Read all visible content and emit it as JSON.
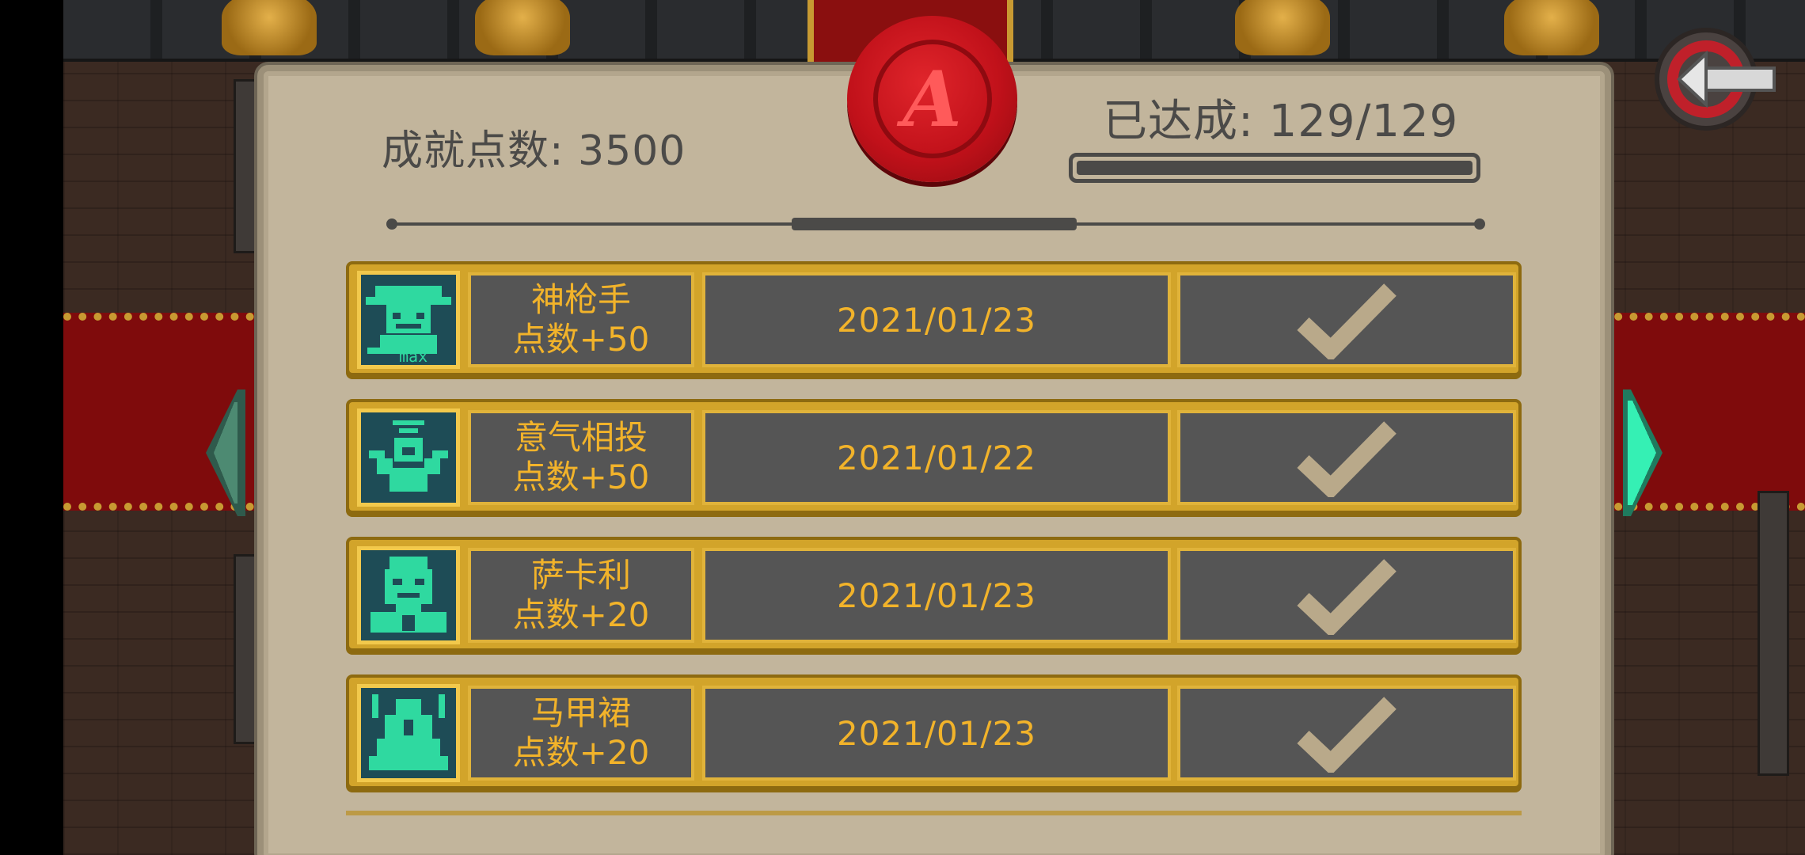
{
  "header": {
    "points_label": "成就点数: 3500",
    "done_label": "已达成: 129/129",
    "progress_fraction": 1.0
  },
  "achievements": [
    {
      "icon": "gunslinger-icon",
      "name": "神枪手",
      "points": "点数+50",
      "date": "2021/01/23",
      "status": "check-icon"
    },
    {
      "icon": "harmony-icon",
      "name": "意气相投",
      "points": "点数+50",
      "date": "2021/01/22",
      "status": "check-icon"
    },
    {
      "icon": "sakary-icon",
      "name": "萨卡利",
      "points": "点数+20",
      "date": "2021/01/23",
      "status": "check-icon"
    },
    {
      "icon": "vest-dress-icon",
      "name": "马甲裙",
      "points": "点数+20",
      "date": "2021/01/23",
      "status": "check-icon"
    }
  ],
  "colors": {
    "parchment": "#c2b59c",
    "gold": "#d2a42a",
    "text_gold": "#f2b32a",
    "teal_icon": "#2fd9a0",
    "seal_red": "#c1111a"
  }
}
